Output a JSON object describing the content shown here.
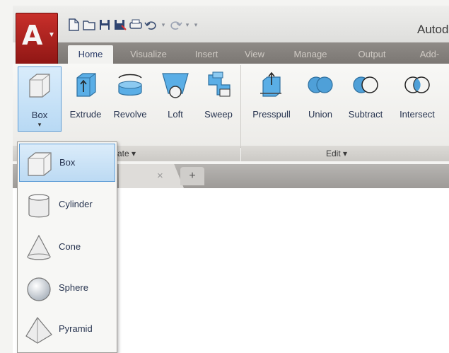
{
  "app": {
    "logo": "A",
    "title": "Autod"
  },
  "tabs": [
    "Home",
    "Visualize",
    "Insert",
    "View",
    "Manage",
    "Output",
    "Add-"
  ],
  "ribbon": {
    "tools": [
      {
        "label": "Box",
        "icon": "box-icon",
        "selected": true
      },
      {
        "label": "Extrude",
        "icon": "extrude-icon"
      },
      {
        "label": "Revolve",
        "icon": "revolve-icon"
      },
      {
        "label": "Loft",
        "icon": "loft-icon"
      },
      {
        "label": "Sweep",
        "icon": "sweep-icon"
      },
      {
        "label": "Presspull",
        "icon": "presspull-icon"
      },
      {
        "label": "Union",
        "icon": "union-icon"
      },
      {
        "label": "Subtract",
        "icon": "subtract-icon"
      },
      {
        "label": "Intersect",
        "icon": "intersect-icon"
      }
    ],
    "panels": {
      "create": "ate ▾",
      "edit": "Edit ▾"
    },
    "box_caret": "▾"
  },
  "doc_tabs": {
    "close": "×",
    "add": "+"
  },
  "dropdown": {
    "items": [
      {
        "label": "Box",
        "icon": "box-icon",
        "selected": true
      },
      {
        "label": "Cylinder",
        "icon": "cylinder-icon"
      },
      {
        "label": "Cone",
        "icon": "cone-icon"
      },
      {
        "label": "Sphere",
        "icon": "sphere-icon"
      },
      {
        "label": "Pyramid",
        "icon": "pyramid-icon"
      }
    ]
  },
  "colors": {
    "app_red": "#b3201d",
    "accent_blue": "#5d9cd6",
    "icon_blue": "#4fa0d8"
  }
}
